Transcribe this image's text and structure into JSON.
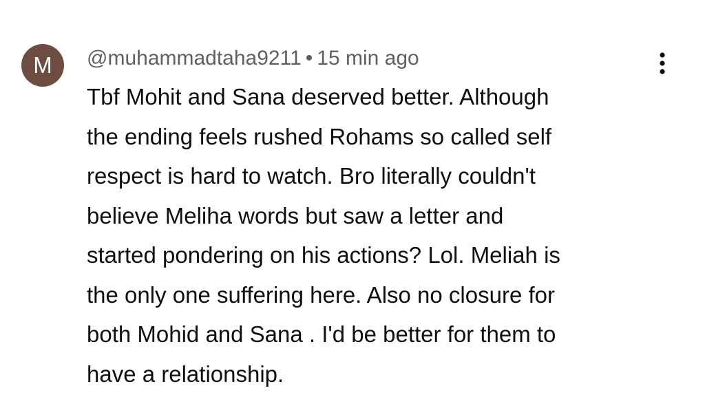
{
  "comment": {
    "avatar": {
      "initial": "M",
      "color": "#6d4c41"
    },
    "author": "@muhammadtaha9211",
    "separator": "•",
    "timestamp": "15 min ago",
    "lines": [
      "Tbf Mohit and Sana deserved better. Although",
      "the ending feels rushed Rohams so called self",
      "respect is hard to watch. Bro literally couldn't",
      "believe Meliha words but saw a letter and",
      "started pondering on his actions? Lol. Meliah is",
      "the only one suffering here. Also no closure for",
      "both Mohid and Sana . I'd be better for them to",
      "have a relationship."
    ],
    "menu_icon": "more-vertical-icon"
  }
}
